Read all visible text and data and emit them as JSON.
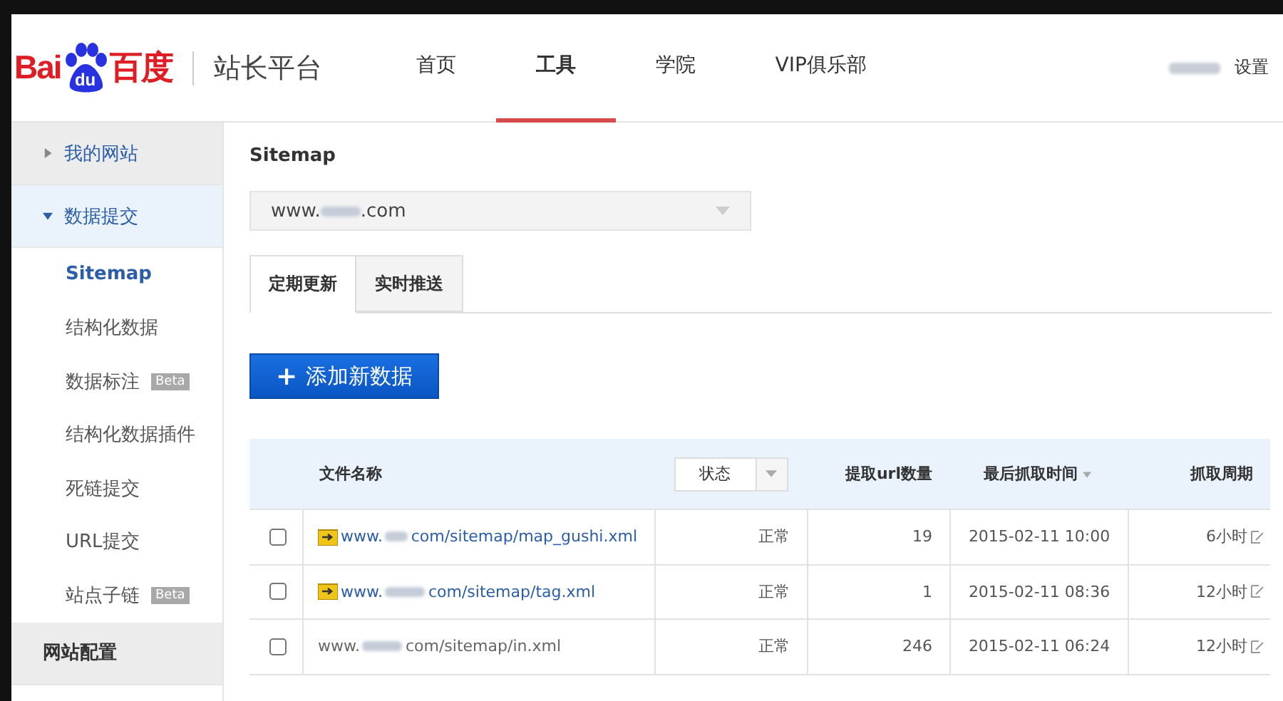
{
  "header": {
    "logo": {
      "bai": "Bai",
      "du": "du",
      "baidu_cn": "百度"
    },
    "product": "站长平台",
    "nav": [
      {
        "label": "首页",
        "selected": false
      },
      {
        "label": "工具",
        "selected": true
      },
      {
        "label": "学院",
        "selected": false
      },
      {
        "label": "VIP俱乐部",
        "selected": false
      }
    ],
    "settings": "设置"
  },
  "sidebar": {
    "groups": [
      {
        "label": "我的网站",
        "expanded": false
      },
      {
        "label": "数据提交",
        "expanded": true,
        "children": [
          {
            "label": "Sitemap",
            "selected": true
          },
          {
            "label": "结构化数据",
            "selected": false
          },
          {
            "label": "数据标注",
            "selected": false,
            "badge": "Beta"
          },
          {
            "label": "结构化数据插件",
            "selected": false
          },
          {
            "label": "死链提交",
            "selected": false
          },
          {
            "label": "URL提交",
            "selected": false
          },
          {
            "label": "站点子链",
            "selected": false,
            "badge": "Beta"
          }
        ]
      },
      {
        "label": "网站配置",
        "kind": "heading"
      }
    ]
  },
  "content": {
    "title": "Sitemap",
    "site_select": {
      "prefix": "www.",
      "suffix": ".com"
    },
    "tabs": [
      {
        "label": "定期更新",
        "selected": true
      },
      {
        "label": "实时推送",
        "selected": false
      }
    ],
    "add_button": {
      "icon": "+",
      "label": "添加新数据"
    },
    "table": {
      "columns": [
        {
          "label": "文件名称",
          "kind": "text"
        },
        {
          "label": "状态",
          "kind": "filter"
        },
        {
          "label": "提取url数量",
          "kind": "text"
        },
        {
          "label": "最后抓取时间",
          "kind": "sort"
        },
        {
          "label": "抓取周期",
          "kind": "text"
        }
      ],
      "rows": [
        {
          "checked": false,
          "kind": "index",
          "prefix": "www.",
          "path": "com/sitemap/map_gushi.xml",
          "status": "正常",
          "count": "19",
          "time": "2015-02-11 10:00",
          "period": "6小时"
        },
        {
          "checked": false,
          "kind": "index",
          "prefix": "www.",
          "path": "com/sitemap/tag.xml",
          "status": "正常",
          "count": "1",
          "time": "2015-02-11 08:36",
          "period": "12小时"
        },
        {
          "checked": false,
          "kind": "plain",
          "prefix": "www.",
          "path": "com/sitemap/in.xml",
          "status": "正常",
          "count": "246",
          "time": "2015-02-11 06:24",
          "period": "12小时"
        }
      ]
    }
  }
}
